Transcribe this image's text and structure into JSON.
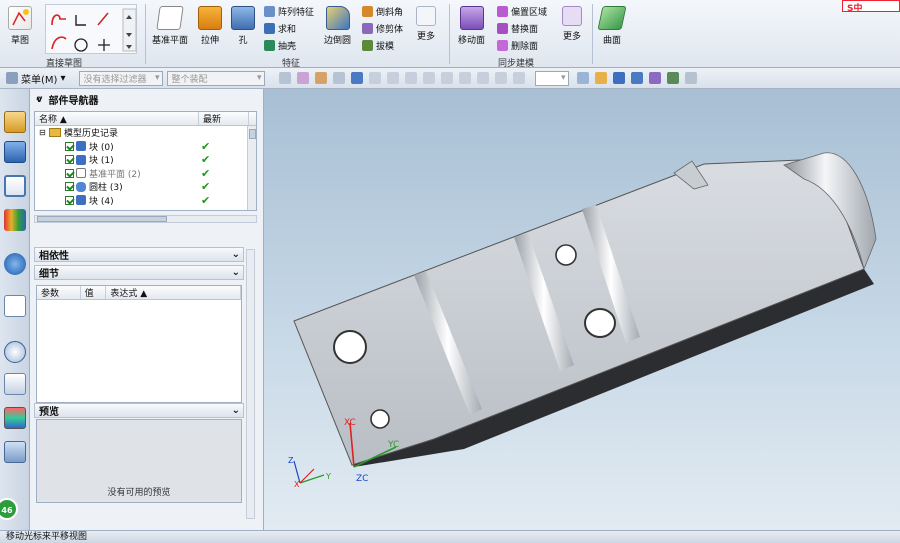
{
  "ribbon": {
    "direct_sketch": {
      "sketch_label": "草图",
      "group_label": "直接草图"
    },
    "feature": {
      "datum_plane_label": "基准平面",
      "extrude_label": "拉伸",
      "hole_label": "孔",
      "edge_blend_label": "边倒圆",
      "small_items": [
        "阵列特征",
        "求和",
        "抽壳"
      ],
      "chamfer_label": "倒斜角",
      "trim_body_label": "修剪体",
      "draft_label": "拔模",
      "more_label": "更多",
      "group_label": "特征"
    },
    "sync_modeling": {
      "move_face_label": "移动面",
      "small_items": [
        "偏置区域",
        "替换面",
        "删除面"
      ],
      "more_label": "更多",
      "group_label": "同步建模"
    },
    "surface": {
      "surface_label": "曲面"
    }
  },
  "toolbar": {
    "menu_label": "菜单(M)",
    "selection_filter": "没有选择过滤器",
    "scope": "整个装配"
  },
  "navigator": {
    "title": "部件导航器",
    "columns": {
      "name": "名称",
      "latest": "最新"
    },
    "root": "模型历史记录",
    "features": [
      {
        "name": "块 (0)",
        "latest": "✔"
      },
      {
        "name": "块 (1)",
        "latest": "✔"
      },
      {
        "name": "基准平面 (2)",
        "latest": "✔"
      },
      {
        "name": "圆柱 (3)",
        "latest": "✔"
      },
      {
        "name": "块 (4)",
        "latest": "✔"
      }
    ],
    "dependencies_label": "相依性",
    "details_label": "细节",
    "detail_columns": {
      "parameter": "参数",
      "value": "值",
      "expression": "表达式"
    },
    "preview_label": "预览",
    "preview_empty": "没有可用的预览"
  },
  "viewport": {
    "csys_labels": {
      "xc": "XC",
      "yc": "YC",
      "zc": "ZC"
    },
    "triad_labels": {
      "x": "X",
      "y": "Y",
      "z": "Z"
    }
  },
  "status": {
    "text": "移动光标来平移视图"
  },
  "badge": {
    "text": "46"
  },
  "brand": {
    "text": "S中"
  },
  "colors": {
    "check_green": "#1a9a1a",
    "viewport_top": "#a8bfd4",
    "viewport_bottom": "#e2ebf2"
  }
}
